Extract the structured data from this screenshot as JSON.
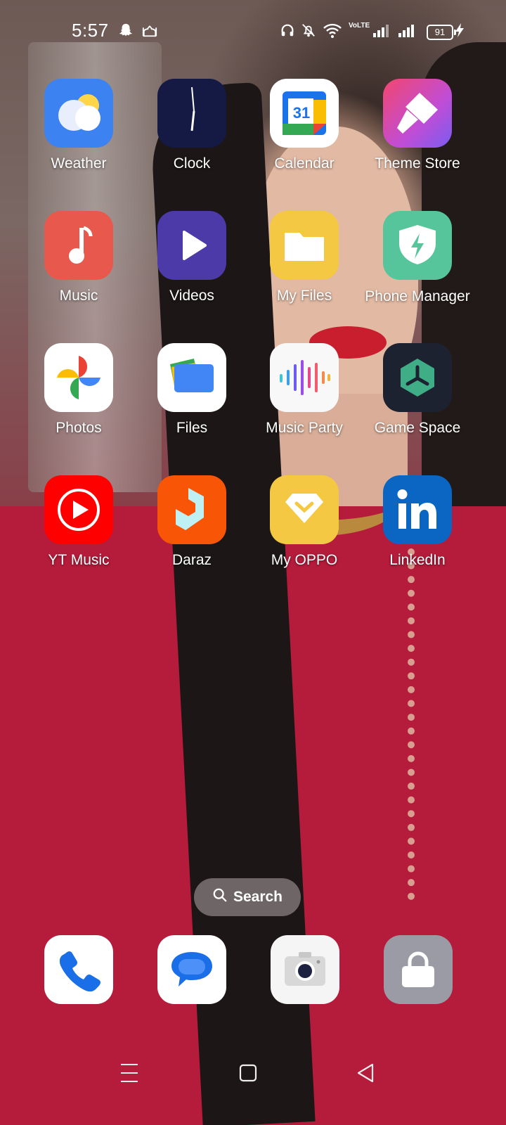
{
  "status_bar": {
    "time": "5:57",
    "icons": [
      "snapchat-icon",
      "mosque-icon",
      "headphones-icon",
      "bell-off-icon",
      "wifi-icon",
      "volte-icon",
      "signal-icon",
      "signal-icon",
      "battery-icon",
      "charging-icon"
    ],
    "volte": "VoLTE",
    "battery_level": "91"
  },
  "apps": [
    {
      "label": "Weather",
      "icon": "weather-icon",
      "color": "#3c82f0"
    },
    {
      "label": "Clock",
      "icon": "clock-icon",
      "color": "#141a44"
    },
    {
      "label": "Calendar",
      "icon": "calendar-icon",
      "color": "#ffffff",
      "date": "31"
    },
    {
      "label": "Theme Store",
      "icon": "theme-store-icon",
      "color": "#e8407a"
    },
    {
      "label": "Music",
      "icon": "music-icon",
      "color": "#e8584c"
    },
    {
      "label": "Videos",
      "icon": "videos-icon",
      "color": "#4b3aa8"
    },
    {
      "label": "My Files",
      "icon": "folder-icon",
      "color": "#f4c842"
    },
    {
      "label": "Phone Manager",
      "icon": "shield-icon",
      "color": "#56c59c"
    },
    {
      "label": "Photos",
      "icon": "photos-icon",
      "color": "#ffffff"
    },
    {
      "label": "Files",
      "icon": "files-icon",
      "color": "#ffffff"
    },
    {
      "label": "Music Party",
      "icon": "music-party-icon",
      "color": "#f8f8f8"
    },
    {
      "label": "Game Space",
      "icon": "game-space-icon",
      "color": "#1d2230"
    },
    {
      "label": "YT Music",
      "icon": "yt-music-icon",
      "color": "#ff0000"
    },
    {
      "label": "Daraz",
      "icon": "daraz-icon",
      "color": "#f85606"
    },
    {
      "label": "My OPPO",
      "icon": "my-oppo-icon",
      "color": "#f4c842"
    },
    {
      "label": "LinkedIn",
      "icon": "linkedin-icon",
      "color": "#0a66c2"
    }
  ],
  "search": {
    "label": "Search"
  },
  "dock": [
    {
      "icon": "phone-icon"
    },
    {
      "icon": "messages-icon"
    },
    {
      "icon": "camera-icon"
    },
    {
      "icon": "lock-icon"
    }
  ],
  "nav": [
    "menu-icon",
    "home-icon",
    "back-icon"
  ]
}
